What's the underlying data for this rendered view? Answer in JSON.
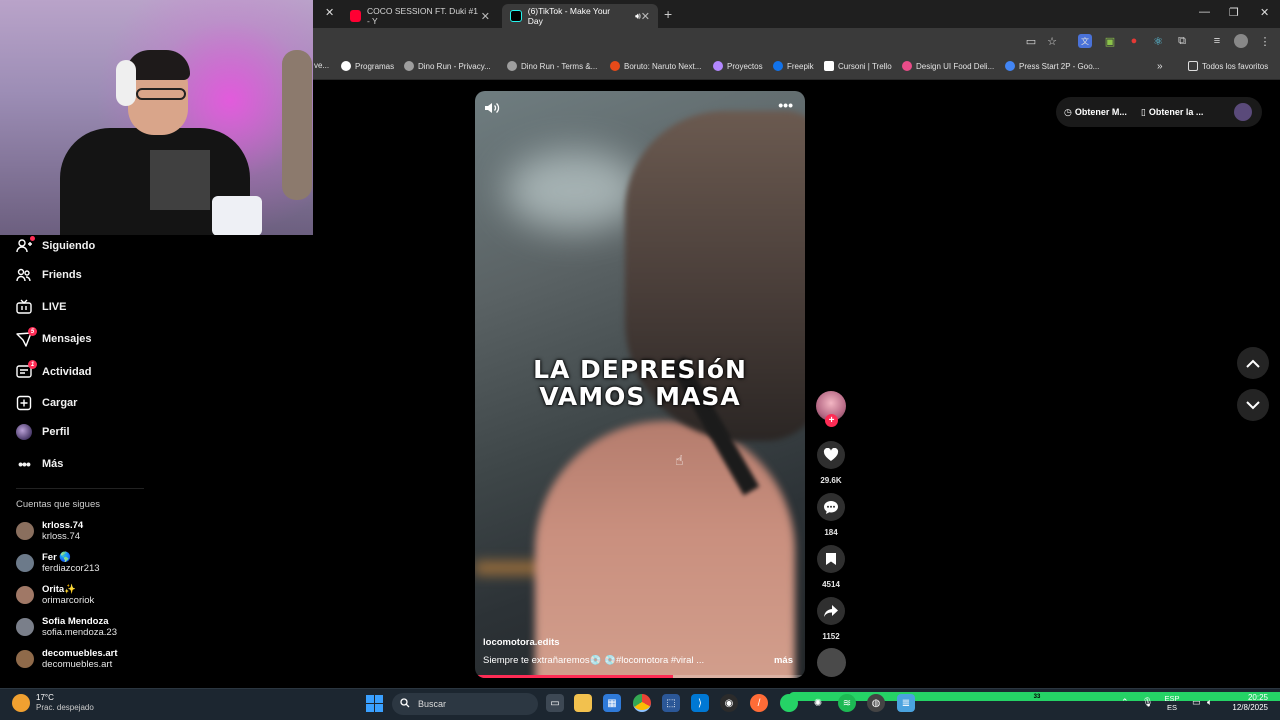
{
  "browser": {
    "tabs": [
      {
        "label": "COCO SESSION FT. Duki #1 - Y",
        "favicon_color": "#ff0033"
      },
      {
        "label": "(6)TikTok - Make Your Day",
        "favicon_color": "#000000"
      }
    ],
    "bookmarks": [
      {
        "label": "Programas",
        "color": "#ffffff"
      },
      {
        "label": "Dino Run - Privacy...",
        "color": "#9e9e9e"
      },
      {
        "label": "Dino Run - Terms &...",
        "color": "#9e9e9e"
      },
      {
        "label": "Boruto: Naruto Next...",
        "color": "#e64a19"
      },
      {
        "label": "Proyectos",
        "color": "#b388ff"
      },
      {
        "label": "Freepik",
        "color": "#1273eb"
      },
      {
        "label": "Cursoni | Trello",
        "color": "#ffffff"
      },
      {
        "label": "Design UI Food Deli...",
        "color": "#ea4c89"
      },
      {
        "label": "Press Start 2P - Goo...",
        "color": "#4285f4"
      }
    ],
    "bookmark_prefix": "ve...",
    "all_bookmarks": "Todos los favoritos"
  },
  "sidebar": {
    "items": [
      {
        "label": "Siguiendo",
        "icon": "following-icon",
        "badge": ""
      },
      {
        "label": "Friends",
        "icon": "friends-icon",
        "badge": ""
      },
      {
        "label": "LIVE",
        "icon": "live-icon",
        "badge": ""
      },
      {
        "label": "Mensajes",
        "icon": "messages-icon",
        "badge": "5"
      },
      {
        "label": "Actividad",
        "icon": "activity-icon",
        "badge": "1"
      },
      {
        "label": "Cargar",
        "icon": "upload-icon",
        "badge": ""
      },
      {
        "label": "Perfil",
        "icon": "profile-avatar",
        "badge": ""
      },
      {
        "label": "Más",
        "icon": "more-icon",
        "badge": ""
      }
    ],
    "following_title": "Cuentas que sigues",
    "following": [
      {
        "name": "krloss.74",
        "handle": "krloss.74",
        "color": "#8a6f5e"
      },
      {
        "name": "Fer 🌎",
        "handle": "ferdiazcor213",
        "color": "#6c7a8a"
      },
      {
        "name": "Orita✨",
        "handle": "orimarcoriok",
        "color": "#a07866"
      },
      {
        "name": "Sofia Mendoza",
        "handle": "sofia.mendoza.23",
        "color": "#7a7f8a"
      },
      {
        "name": "decomuebles.art",
        "handle": "decomuebles.art",
        "color": "#8f6a4a"
      }
    ]
  },
  "video": {
    "caption_line1": "LA DEPRESIóN",
    "caption_line2": "VAMOS MASA",
    "author": "locomotora.edits",
    "description": "Siempre te extrañaremos💿 💿#locomotora  #viral  ...",
    "more": "más",
    "progress_fraction": 0.6
  },
  "actions": {
    "likes": "29.6K",
    "comments": "184",
    "saves": "4514",
    "shares": "1152"
  },
  "header_right": {
    "get_coins": "Obtener M...",
    "get_app": "Obtener la ..."
  },
  "taskbar": {
    "weather_temp": "17°C",
    "weather_desc": "Prac. despejado",
    "search_label": "Buscar",
    "lang_top": "ESP",
    "lang_bottom": "ES",
    "time": "20:25",
    "date": "12/8/2025",
    "whatsapp_badge": "33"
  }
}
